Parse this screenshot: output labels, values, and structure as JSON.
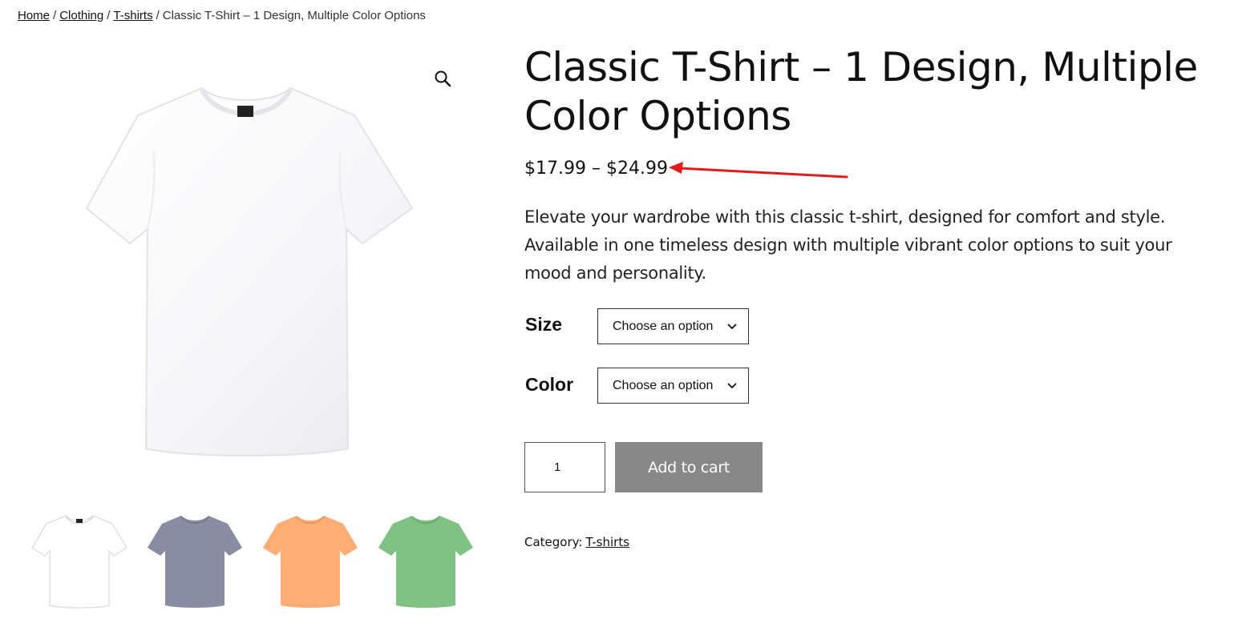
{
  "breadcrumb": {
    "home": "Home",
    "clothing": "Clothing",
    "tshirts": "T-shirts",
    "separator": "/",
    "current": "Classic T-Shirt – 1 Design, Multiple Color Options"
  },
  "product": {
    "title": "Classic T-Shirt – 1 Design, Multiple Color Options",
    "price_range": "$17.99 – $24.99",
    "description": "Elevate your wardrobe with this classic t-shirt, designed for comfort and style. Available in one timeless design with multiple vibrant color options to suit your mood and personality.",
    "main_image_icon": "white-tshirt-image",
    "zoom_icon": "magnifier-icon"
  },
  "thumbnails": [
    {
      "name": "white",
      "color": "#ffffff"
    },
    {
      "name": "slate",
      "color": "#8a8ca3"
    },
    {
      "name": "orange",
      "color": "#ffad74"
    },
    {
      "name": "green",
      "color": "#7fc283"
    }
  ],
  "options": {
    "size": {
      "label": "Size",
      "selected": "Choose an option"
    },
    "color": {
      "label": "Color",
      "selected": "Choose an option"
    }
  },
  "cart": {
    "quantity": "1",
    "add_label": "Add to cart",
    "button_color": "#888888"
  },
  "category": {
    "label": "Category:",
    "value": "T-shirts"
  },
  "annotation": {
    "arrow_color": "#e01c1c"
  }
}
